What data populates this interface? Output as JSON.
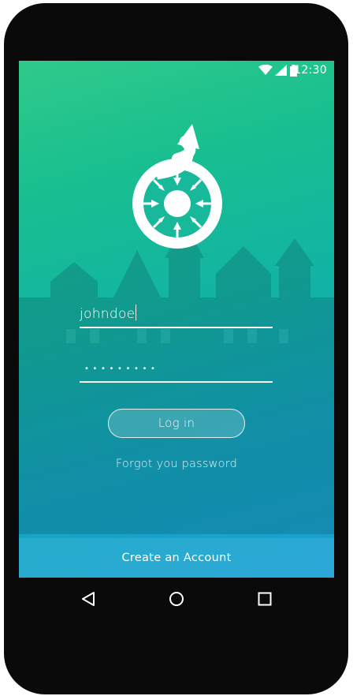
{
  "status_bar": {
    "time": "12:30",
    "icons": [
      "wifi-icon",
      "signal-icon",
      "battery-icon"
    ]
  },
  "app": {
    "logo": "wikimedia-commons-logo"
  },
  "login_form": {
    "username_value": "johndoe",
    "password_mask": "•••••••••",
    "login_label": "Log in",
    "forgot_label": "Forgot you password"
  },
  "footer": {
    "create_account_label": "Create an Account"
  },
  "nav_bar": {
    "buttons": [
      "back-icon",
      "home-icon",
      "recents-icon"
    ]
  },
  "colors": {
    "gradient_top": "#2fca8a",
    "gradient_mid": "#12b4a3",
    "gradient_bottom": "#1aa0d6",
    "foreground": "#ffffff",
    "device": "#0a0a0a"
  }
}
